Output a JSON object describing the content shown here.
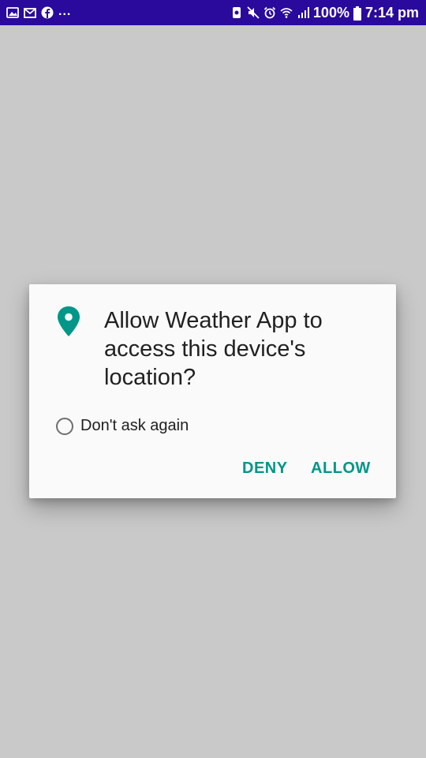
{
  "status_bar": {
    "left_icons": [
      "gallery-icon",
      "gmail-icon",
      "facebook-icon"
    ],
    "overflow": "...",
    "right_icons": [
      "app-notification-icon",
      "mute-icon",
      "alarm-icon",
      "wifi-icon",
      "signal-icon"
    ],
    "battery": "100%",
    "time": "7:14 pm"
  },
  "dialog": {
    "icon": "location-pin-icon",
    "title": "Allow Weather App to access this device's location?",
    "checkbox_label": "Don't ask again",
    "deny_label": "DENY",
    "allow_label": "ALLOW"
  },
  "colors": {
    "status_bar": "#2a0a9c",
    "background": "#c9c9c9",
    "accent": "#009688",
    "dialog": "#fafafa"
  }
}
